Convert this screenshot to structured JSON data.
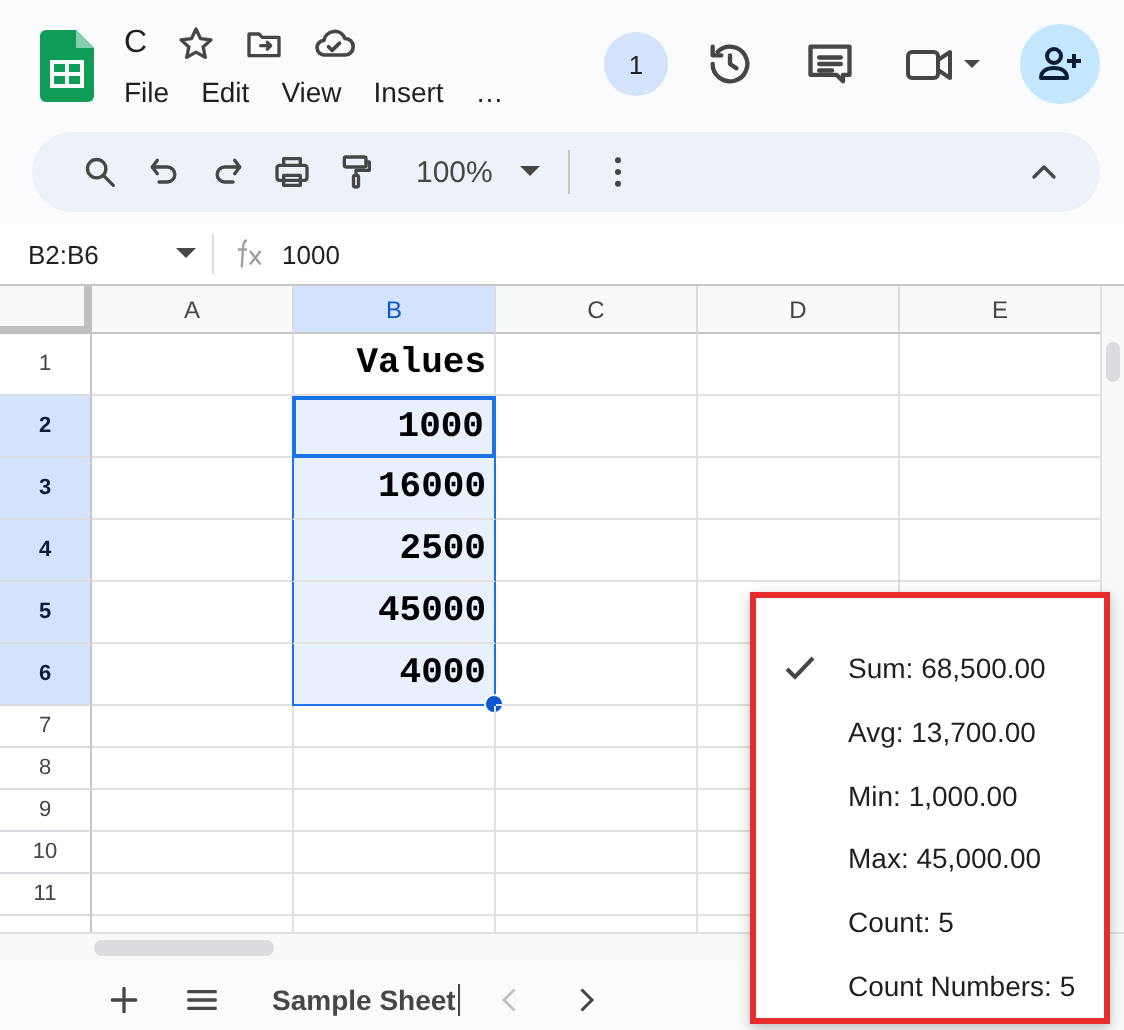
{
  "document": {
    "title": "C",
    "menus": [
      "File",
      "Edit",
      "View",
      "Insert",
      "…"
    ]
  },
  "header": {
    "badge": "1"
  },
  "toolbar": {
    "zoom": "100%"
  },
  "formula_bar": {
    "range": "B2:B6",
    "value": "1000"
  },
  "sheet": {
    "columns": [
      {
        "label": "A",
        "selected": false
      },
      {
        "label": "B",
        "selected": true
      },
      {
        "label": "C",
        "selected": false
      },
      {
        "label": "D",
        "selected": false
      },
      {
        "label": "E",
        "selected": false
      }
    ],
    "rows": [
      {
        "number": "1",
        "selected": false,
        "value": "Values"
      },
      {
        "number": "2",
        "selected": true,
        "value": "1000"
      },
      {
        "number": "3",
        "selected": true,
        "value": "16000"
      },
      {
        "number": "4",
        "selected": true,
        "value": "2500"
      },
      {
        "number": "5",
        "selected": true,
        "value": "45000"
      },
      {
        "number": "6",
        "selected": true,
        "value": "4000"
      },
      {
        "number": "7",
        "selected": false
      },
      {
        "number": "8",
        "selected": false
      },
      {
        "number": "9",
        "selected": false
      },
      {
        "number": "10",
        "selected": false
      },
      {
        "number": "11",
        "selected": false
      }
    ]
  },
  "sheet_tabs": [
    {
      "label": "Sample Sheet",
      "selected": true
    }
  ],
  "summary_menu": {
    "highlighted": true,
    "items": [
      {
        "label": "Sum: 68,500.00",
        "checked": true
      },
      {
        "label": "Avg: 13,700.00",
        "checked": false
      },
      {
        "label": "Min: 1,000.00",
        "checked": false
      },
      {
        "label": "Max: 45,000.00",
        "checked": false
      },
      {
        "label": "Count: 5",
        "checked": false
      },
      {
        "label": "Count Numbers: 5",
        "checked": false
      }
    ]
  }
}
